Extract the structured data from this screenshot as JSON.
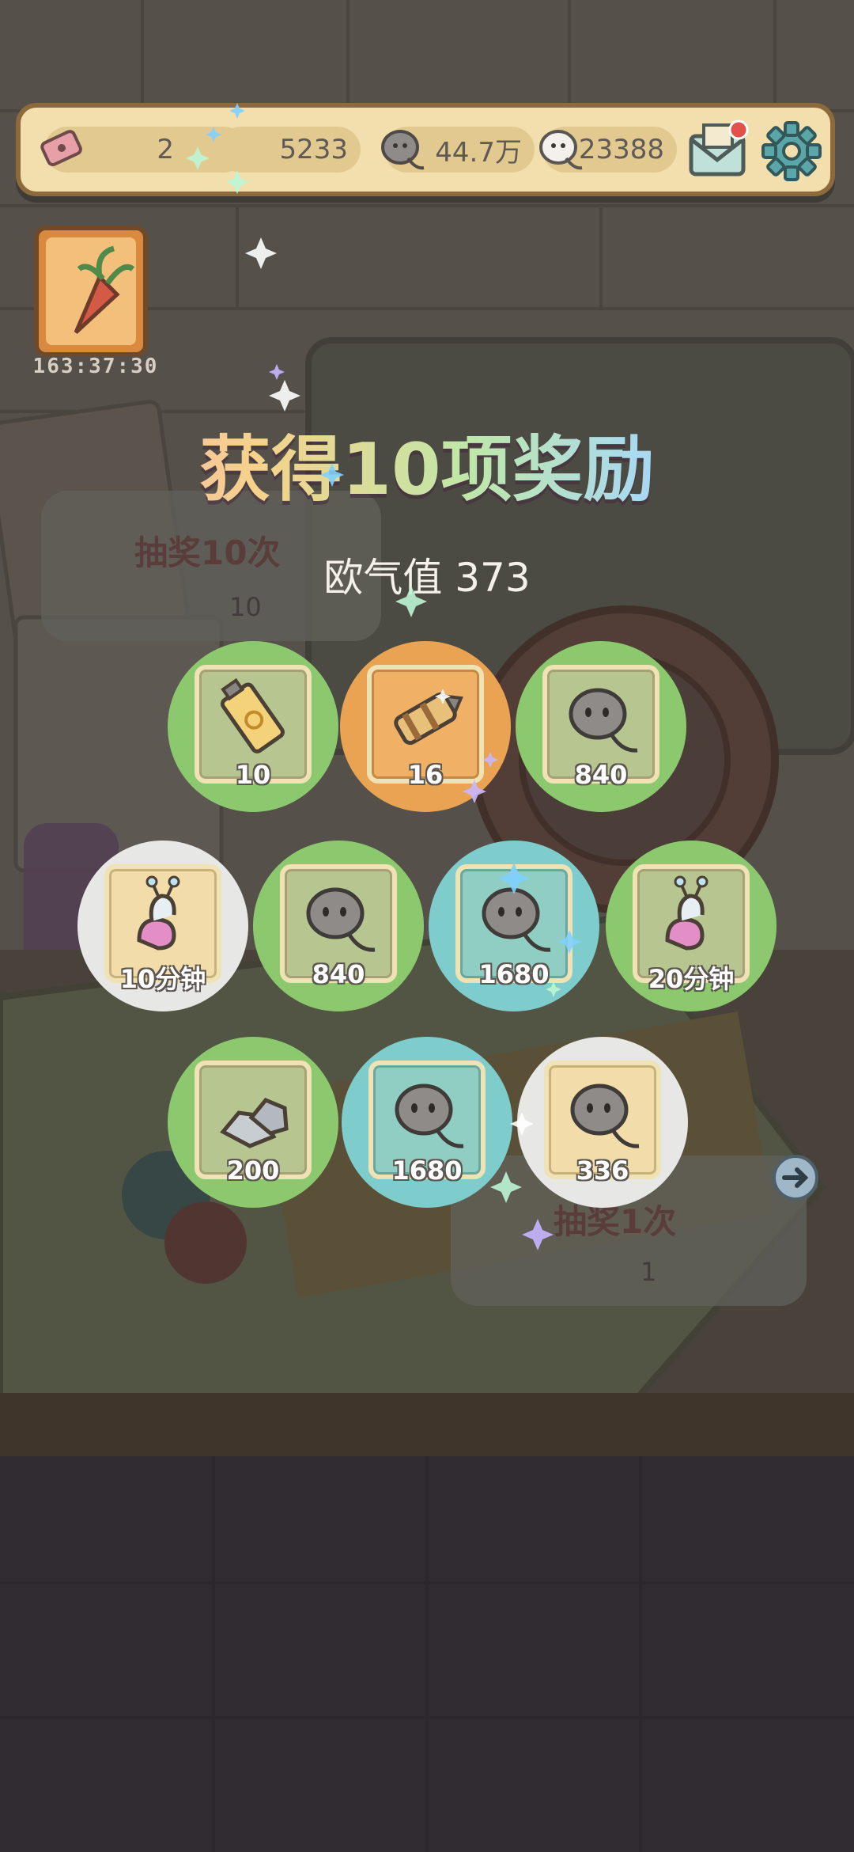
{
  "topbar": {
    "tickets": "2",
    "stat_a": "5233",
    "gold_tadpoles": "44.7万",
    "white_tadpoles": "23388",
    "icons": [
      "ticket-icon",
      "tadpole-icon",
      "white-tadpole-icon",
      "mail-icon",
      "gear-icon"
    ]
  },
  "event": {
    "timer": "163:37:30",
    "icon": "carrot-event-icon"
  },
  "reward_popup": {
    "title": "获得10项奖励",
    "luck_label": "欧气值",
    "luck_value": "373",
    "rewards": [
      {
        "item": "ointment-tube",
        "count": "10",
        "bg": "green"
      },
      {
        "item": "rocket-part",
        "count": "16",
        "bg": "orange"
      },
      {
        "item": "tadpole",
        "count": "840",
        "bg": "green"
      },
      {
        "item": "snail-boost",
        "count": "10分钟",
        "bg": "white"
      },
      {
        "item": "tadpole",
        "count": "840",
        "bg": "green"
      },
      {
        "item": "tadpole",
        "count": "1680",
        "bg": "teal"
      },
      {
        "item": "snail-boost",
        "count": "20分钟",
        "bg": "green"
      },
      {
        "item": "stones",
        "count": "200",
        "bg": "green"
      },
      {
        "item": "tadpole",
        "count": "1680",
        "bg": "teal"
      },
      {
        "item": "tadpole",
        "count": "336",
        "bg": "white"
      }
    ]
  },
  "background_buttons": {
    "draw10_label": "抽奖10次",
    "draw10_cost": "10",
    "draw1_label": "抽奖1次",
    "draw1_cost": "1"
  },
  "colors": {
    "bar_bg": "#f3dfad",
    "bar_border": "#8d6a3c",
    "green_circle": "#8cc96e",
    "orange_circle": "#e9a353",
    "teal_circle": "#7fcccc",
    "white_circle": "#e7e7e5"
  }
}
